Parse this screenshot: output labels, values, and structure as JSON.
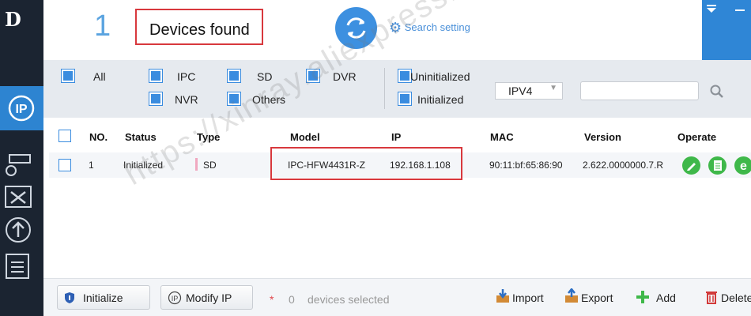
{
  "sidebar": {
    "logo": "D",
    "items": [
      "ip-config-icon",
      "camera-settings-icon",
      "tools-icon",
      "upgrade-icon",
      "document-icon"
    ]
  },
  "header": {
    "device_count": "1",
    "found_label": "Devices found",
    "search_setting_label": "Search setting"
  },
  "filters": {
    "types": [
      {
        "label": "All",
        "checked": true
      },
      {
        "label": "IPC",
        "checked": true
      },
      {
        "label": "SD",
        "checked": true
      },
      {
        "label": "DVR",
        "checked": true
      },
      {
        "label": "NVR",
        "checked": true
      },
      {
        "label": "Others",
        "checked": true
      }
    ],
    "states": [
      {
        "label": "Uninitialized",
        "checked": true
      },
      {
        "label": "Initialized",
        "checked": true
      }
    ],
    "ip_version": "IPV4",
    "search_value": ""
  },
  "table": {
    "headers": [
      "NO.",
      "Status",
      "Type",
      "Model",
      "IP",
      "MAC",
      "Version",
      "Operate"
    ],
    "rows": [
      {
        "no": "1",
        "status": "Initialized",
        "type": "SD",
        "model": "IPC-HFW4431R-Z",
        "ip": "192.168.1.108",
        "mac": "90:11:bf:65:86:90",
        "version": "2.622.0000000.7.R"
      }
    ]
  },
  "bottom": {
    "initialize_label": "Initialize",
    "modify_ip_label": "Modify IP",
    "asterisk": "*",
    "selected_count": "0",
    "selected_label": "devices selected",
    "import_label": "Import",
    "export_label": "Export",
    "add_label": "Add",
    "delete_label": "Delete"
  },
  "watermark": "https://xinray.aliexpress.com/store/3",
  "colors": {
    "accent": "#3a8cdf",
    "sidebar": "#1b2431",
    "highlight": "#d8383d",
    "operate": "#3fb84a"
  }
}
